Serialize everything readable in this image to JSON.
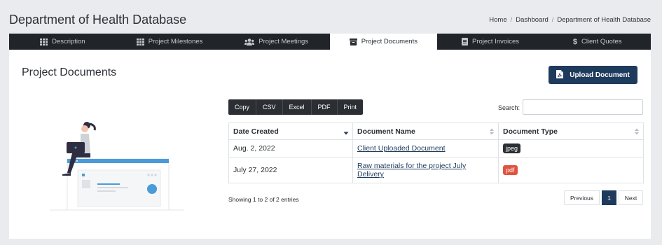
{
  "header": {
    "title": "Department of Health Database",
    "breadcrumb": [
      "Home",
      "Dashboard",
      "Department of Health Database"
    ]
  },
  "tabs": [
    {
      "label": "Description",
      "icon": "grid-icon",
      "active": false
    },
    {
      "label": "Project Milestones",
      "icon": "grid-icon",
      "active": false
    },
    {
      "label": "Project Meetings",
      "icon": "users-icon",
      "active": false
    },
    {
      "label": "Project Documents",
      "icon": "archive-icon",
      "active": true
    },
    {
      "label": "Project Invoices",
      "icon": "file-lines-icon",
      "active": false
    },
    {
      "label": "Client Quotes",
      "icon": "dollar-icon",
      "active": false
    }
  ],
  "section": {
    "title": "Project Documents",
    "upload_label": "Upload Document"
  },
  "export_buttons": [
    "Copy",
    "CSV",
    "Excel",
    "PDF",
    "Print"
  ],
  "search": {
    "label": "Search:",
    "value": ""
  },
  "table": {
    "headers": [
      "Date Created",
      "Document Name",
      "Document Type"
    ],
    "rows": [
      {
        "date": "Aug. 2, 2022",
        "name": "Client Uploaded Document",
        "type": "jpeg",
        "type_color": "#2b2f33"
      },
      {
        "date": "July 27, 2022",
        "name": "Raw materials for the project July Delivery",
        "type": "pdf",
        "type_color": "#e0533f"
      }
    ]
  },
  "footer": {
    "info": "Showing 1 to 2 of 2 entries",
    "previous": "Previous",
    "page": "1",
    "next": "Next"
  },
  "colors": {
    "primary": "#1e3a5c",
    "dark": "#212529",
    "accent": "#4a9bd9"
  }
}
